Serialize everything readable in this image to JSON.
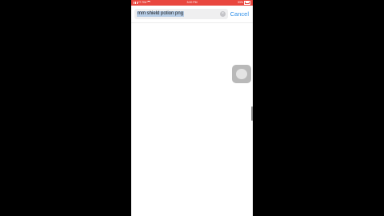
{
  "status_bar": {
    "carrier": "IT-TIM",
    "time": "3:00 PM",
    "battery": "33%"
  },
  "search": {
    "query": "mm shield potion png",
    "cancel_label": "Cancel",
    "clear_icon": "clear-icon"
  },
  "colors": {
    "status_bar": "#e9473f",
    "accent": "#2f8fe8",
    "selection": "#b7cde6"
  }
}
